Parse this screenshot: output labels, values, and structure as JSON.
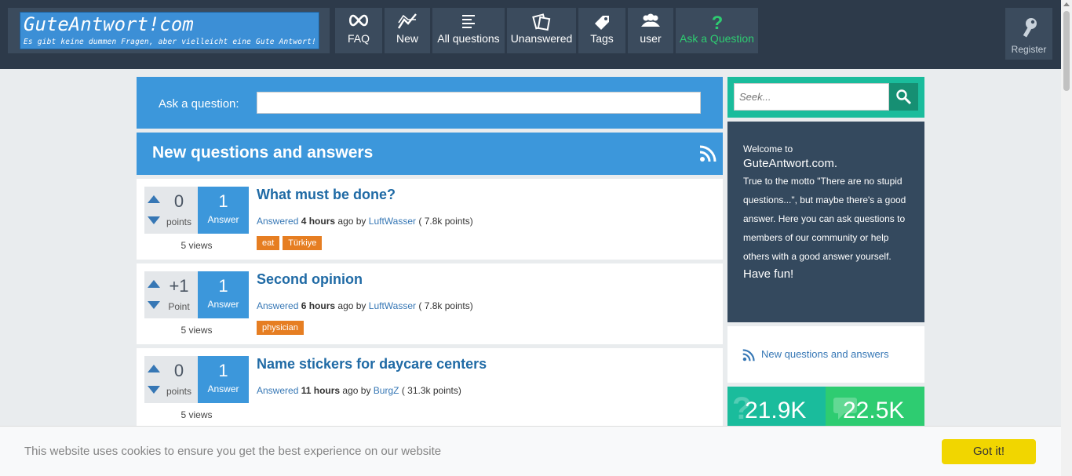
{
  "logo": {
    "title": "GuteAntwort!com",
    "subtitle": "Es gibt keine dummen Fragen, aber vielleicht eine Gute Antwort!"
  },
  "nav": [
    {
      "label": "FAQ",
      "icon": "infinity-icon"
    },
    {
      "label": "New",
      "icon": "trend-icon"
    },
    {
      "label": "All questions",
      "icon": "list-icon"
    },
    {
      "label": "Unanswered",
      "icon": "papers-icon"
    },
    {
      "label": "Tags",
      "icon": "tag-icon"
    },
    {
      "label": "user",
      "icon": "users-icon"
    },
    {
      "label": "Ask a Question",
      "icon": "question-mark-icon",
      "color": "#2ecc71"
    }
  ],
  "register": {
    "label": "Register",
    "icon": "key-icon"
  },
  "ask": {
    "label": "Ask a question:",
    "value": ""
  },
  "section": {
    "title": "New questions and answers"
  },
  "questions": [
    {
      "votes": "0",
      "votes_label": "points",
      "answers": "1",
      "answers_label": "Answer",
      "views": "5 views",
      "title": "What must be done?",
      "status": "Answered",
      "time": "4 hours",
      "ago": "ago by",
      "user": "LuftWasser",
      "points": "( 7.8k points)",
      "tags": [
        "eat",
        "Türkiye"
      ]
    },
    {
      "votes": "+1",
      "votes_label": "Point",
      "answers": "1",
      "answers_label": "Answer",
      "views": "5 views",
      "title": "Second opinion",
      "status": "Answered",
      "time": "6 hours",
      "ago": "ago by",
      "user": "LuftWasser",
      "points": "( 7.8k points)",
      "tags": [
        "physician"
      ]
    },
    {
      "votes": "0",
      "votes_label": "points",
      "answers": "1",
      "answers_label": "Answer",
      "views": "5 views",
      "title": "Name stickers for daycare centers",
      "status": "Answered",
      "time": "11 hours",
      "ago": "ago by",
      "user": "BurgZ",
      "points": "( 31.3k points)",
      "tags": []
    }
  ],
  "search": {
    "placeholder": "Seek..."
  },
  "welcome": {
    "line1": "Welcome to",
    "line2": "GuteAntwort.com.",
    "body": "True to the motto \"There are no stupid questions...\", but maybe there's a good answer. Here you can ask questions to members of our community or help others with a good answer yourself.",
    "fun": "Have fun!"
  },
  "feed": {
    "label": "New questions and answers"
  },
  "stats": [
    {
      "value": "21.9K",
      "color": "#1abc9c"
    },
    {
      "value": "22.5K",
      "color": "#2ecc71"
    }
  ],
  "cookie": {
    "message": "This website uses cookies to ensure you get the best experience on our website",
    "button": "Got it!"
  }
}
